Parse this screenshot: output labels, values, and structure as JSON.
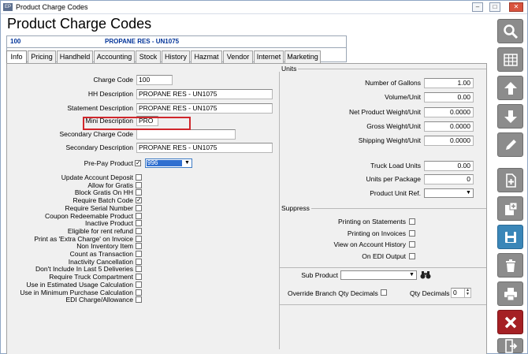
{
  "window": {
    "title": "Product Charge Codes",
    "app_icon": "EP",
    "min": "–",
    "max": "□",
    "close": "✕"
  },
  "page": {
    "heading": "Product Charge Codes"
  },
  "record": {
    "code": "100",
    "description": "PROPANE RES - UN1075"
  },
  "tabs": [
    "Info",
    "Pricing",
    "Handheld",
    "Accounting",
    "Stock",
    "History",
    "Hazmat",
    "Vendor",
    "Internet",
    "Marketing"
  ],
  "info": {
    "charge_code_label": "Charge Code",
    "charge_code": "100",
    "hh_desc_label": "HH Description",
    "hh_desc": "PROPANE RES - UN1075",
    "stmt_desc_label": "Statement Description",
    "stmt_desc": "PROPANE RES - UN1075",
    "mini_desc_label": "Mini Description",
    "mini_desc": "PRO",
    "sec_code_label": "Secondary Charge Code",
    "sec_code": "",
    "sec_desc_label": "Secondary Description",
    "sec_desc": "PROPANE RES - UN1075",
    "prepay_label": "Pre-Pay Product",
    "prepay_value": "996"
  },
  "checkboxes": [
    {
      "label": "Update Account Deposit",
      "checked": false
    },
    {
      "label": "Allow for Gratis",
      "checked": false
    },
    {
      "label": "Block Gratis On HH",
      "checked": false
    },
    {
      "label": "Require Batch Code",
      "checked": true
    },
    {
      "label": "Require Serial Number",
      "checked": false
    },
    {
      "label": "Coupon Redeemable Product",
      "checked": false
    },
    {
      "label": "Inactive Product",
      "checked": false
    },
    {
      "label": "Eligible for rent refund",
      "checked": false
    },
    {
      "label": "Print as 'Extra Charge' on Invoice",
      "checked": false
    },
    {
      "label": "Non Inventory Item",
      "checked": false
    },
    {
      "label": "Count as Transaction",
      "checked": false
    },
    {
      "label": "Inactivity Cancellation",
      "checked": false
    },
    {
      "label": "Don't Include In Last 5 Deliveries",
      "checked": false
    },
    {
      "label": "Require Truck Compartment",
      "checked": false
    },
    {
      "label": "Use in Estimated Usage Calculation",
      "checked": false
    },
    {
      "label": "Use in Minimum Purchase Calculation",
      "checked": false
    },
    {
      "label": "EDI Charge/Allowance",
      "checked": false
    }
  ],
  "units": {
    "title": "Units",
    "gallons_label": "Number of Gallons",
    "gallons": "1.00",
    "volume_label": "Volume/Unit",
    "volume": "0.00",
    "net_weight_label": "Net Product Weight/Unit",
    "net_weight": "0.0000",
    "gross_weight_label": "Gross Weight/Unit",
    "gross_weight": "0.0000",
    "ship_weight_label": "Shipping Weight/Unit",
    "ship_weight": "0.0000",
    "truck_load_label": "Truck Load Units",
    "truck_load": "0.00",
    "per_package_label": "Units per Package",
    "per_package": "0",
    "unit_ref_label": "Product Unit Ref.",
    "unit_ref": ""
  },
  "suppress": {
    "title": "Suppress",
    "items": [
      {
        "label": "Printing on Statements",
        "checked": false
      },
      {
        "label": "Printing on Invoices",
        "checked": false
      },
      {
        "label": "View on Account History",
        "checked": false
      },
      {
        "label": "On EDI Output",
        "checked": false
      }
    ]
  },
  "sub": {
    "sub_product_label": "Sub Product",
    "sub_product": "",
    "override_label": "Override Branch Qty Decimals",
    "qty_decimals_label": "Qty Decimals",
    "qty_decimals": "0"
  },
  "toolbar": [
    "search-icon",
    "grid-icon",
    "arrow-up-icon",
    "arrow-down-icon",
    "edit-icon",
    "new-document-icon",
    "copy-icon",
    "save-icon",
    "delete-icon",
    "print-icon",
    "cancel-icon",
    "exit-icon"
  ]
}
